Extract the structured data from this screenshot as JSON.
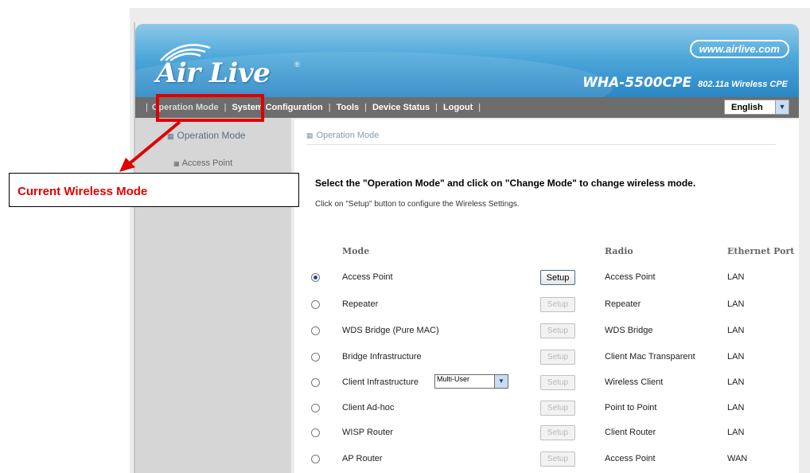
{
  "header": {
    "logo_text": "Air Live",
    "logo_reg": "®",
    "website": "www.airlive.com",
    "model": "WHA-5500CPE",
    "model_desc": "802.11a Wireless CPE"
  },
  "nav": {
    "items": [
      "Operation Mode",
      "System Configuration",
      "Tools",
      "Device Status",
      "Logout"
    ],
    "separator": "|",
    "language": "English"
  },
  "sidebar": {
    "section": "Operation Mode",
    "item": "Access Point"
  },
  "content": {
    "breadcrumb": "Operation Mode",
    "instruction": "Select the \"Operation Mode\" and click on \"Change Mode\" to change wireless mode.",
    "sub_instruction": "Click on \"Setup\" button to configure the Wireless Settings.",
    "columns": {
      "mode": "Mode",
      "radio": "Radio",
      "ethernet": "Ethernet Port"
    },
    "setup_label": "Setup",
    "client_select_value": "Multi-User",
    "rows": [
      {
        "mode": "Access Point",
        "radio": "Access Point",
        "ethernet": "LAN",
        "selected": true
      },
      {
        "mode": "Repeater",
        "radio": "Repeater",
        "ethernet": "LAN",
        "selected": false
      },
      {
        "mode": "WDS Bridge (Pure MAC)",
        "radio": "WDS Bridge",
        "ethernet": "LAN",
        "selected": false
      },
      {
        "mode": "Bridge Infrastructure",
        "radio": "Client Mac Transparent",
        "ethernet": "LAN",
        "selected": false
      },
      {
        "mode": "Client Infrastructure",
        "radio": "Wireless Client",
        "ethernet": "LAN",
        "selected": false
      },
      {
        "mode": "Client Ad-hoc",
        "radio": "Point to Point",
        "ethernet": "LAN",
        "selected": false
      },
      {
        "mode": "WISP Router",
        "radio": "Client Router",
        "ethernet": "LAN",
        "selected": false
      },
      {
        "mode": "AP Router",
        "radio": "Access Point",
        "ethernet": "WAN",
        "selected": false
      }
    ]
  },
  "annotation": {
    "label": "Current Wireless Mode",
    "color": "#e00000"
  },
  "colors": {
    "header_blue": "#2a86c4",
    "navbar": "#6d6d6d",
    "sidebar": "#d6d6d6"
  }
}
